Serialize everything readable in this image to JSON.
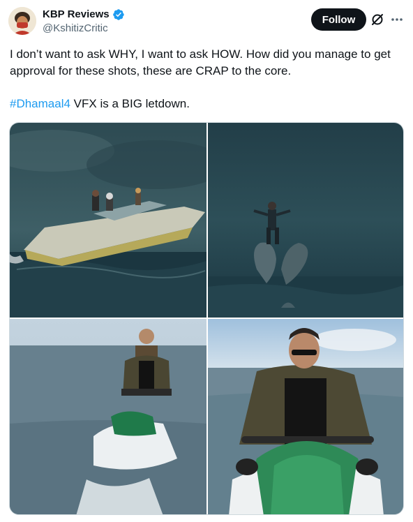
{
  "author": {
    "display_name": "KBP Reviews",
    "handle": "@KshitizCritic",
    "verified": true,
    "avatar_icon": "avatar-icon"
  },
  "actions": {
    "follow_label": "Follow",
    "grok_icon": "grok-icon",
    "more_icon": "more-options-icon"
  },
  "tweet": {
    "line1": "I don’t want to ask WHY, I want to ask HOW. How did you manage to get approval for these shots, these are CRAP to the core.",
    "hashtag": "#Dhamaal4",
    "line2_rest": " VFX is a BIG letdown."
  },
  "media": [
    {
      "name": "media-speedboat-storm"
    },
    {
      "name": "media-man-on-dolphins"
    },
    {
      "name": "media-jetski-wide"
    },
    {
      "name": "media-jetski-closeup"
    }
  ],
  "colors": {
    "link": "#1d9bf0",
    "verified": "#1d9bf0",
    "text": "#0f1419",
    "secondary": "#536471",
    "follow_bg": "#0f1419"
  }
}
